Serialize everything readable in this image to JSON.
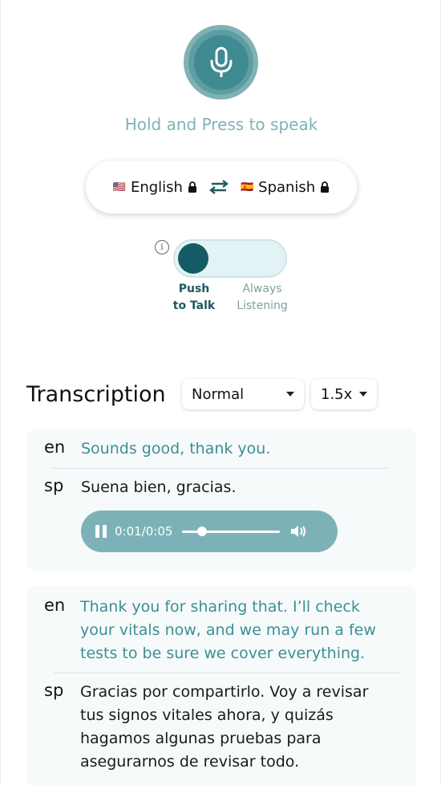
{
  "hint": "Hold and Press to speak",
  "languages": {
    "source": {
      "flag": "🇺🇸",
      "label": "English"
    },
    "target": {
      "flag": "🇪🇸",
      "label": "Spanish"
    }
  },
  "mode": {
    "push_label_1": "Push",
    "push_label_2": "to Talk",
    "listen_label_1": "Always",
    "listen_label_2": "Listening",
    "selected": "Push to Talk",
    "info_icon": "i"
  },
  "transcription": {
    "title": "Transcription",
    "voice_select": "Normal",
    "speed_select": "1.5x"
  },
  "entries": [
    {
      "en_tag": "en",
      "en_text": "Sounds good, thank you.",
      "sp_tag": "sp",
      "sp_text": "Suena bien, gracias.",
      "audio": {
        "time": "0:01/0:05",
        "progress": 0.2
      }
    },
    {
      "en_tag": "en",
      "en_lines": [
        "Thank you for sharing that. I’ll check",
        "your vitals now, and we may run a few",
        "tests to be sure we cover everything."
      ],
      "sp_tag": "sp",
      "sp_lines": [
        "Gracias por compartirlo. Voy a revisar",
        "tus signos vitales ahora, y quizás",
        "hagamos algunas pruebas para",
        "asegurarnos de revisar todo."
      ]
    }
  ],
  "colors": {
    "accent": "#3b8f94",
    "knob": "#145b66",
    "player": "#7cb2b7",
    "hint": "#7fb3b8"
  }
}
